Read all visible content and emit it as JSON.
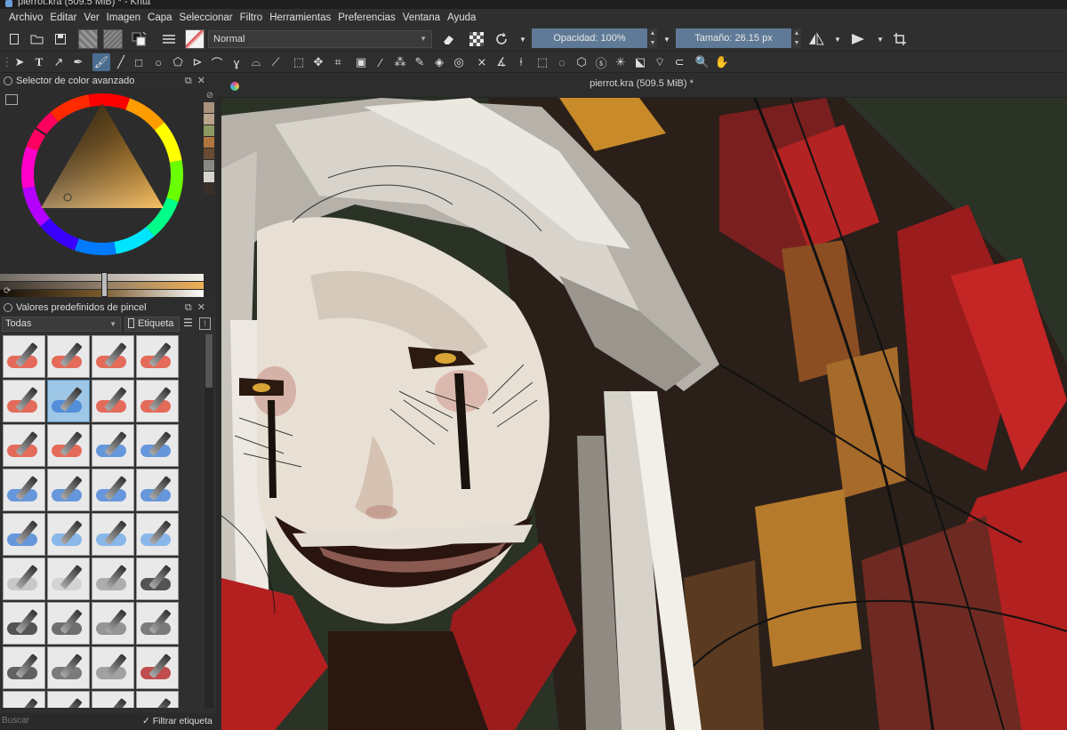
{
  "window": {
    "title": "pierrot.kra (509.5 MiB) * - Krita"
  },
  "menu": {
    "items": [
      "Archivo",
      "Editar",
      "Ver",
      "Imagen",
      "Capa",
      "Seleccionar",
      "Filtro",
      "Herramientas",
      "Preferencias",
      "Ventana",
      "Ayuda"
    ]
  },
  "toolbar": {
    "blend_mode": "Normal",
    "opacity_label": "Opacidad: 100%",
    "size_label": "Tamaño: 26.15 px"
  },
  "color_selector": {
    "title": "Selector de color avanzado",
    "history_colors": [
      "#a8927e",
      "#bba48c",
      "#8c9a62",
      "#b0763e",
      "#6a4a33",
      "#8a8a86",
      "#d8d5cf",
      "#3a2f28"
    ]
  },
  "brush_presets": {
    "title": "Valores predefinidos de pincel",
    "filter_value": "Todas",
    "tag_label": "Etiqueta",
    "search_placeholder": "Buscar",
    "filter_tag_label": "Filtrar etiqueta"
  },
  "document": {
    "tab_title": "pierrot.kra (509.5 MiB) *"
  },
  "colors": {
    "accent": "#4b6d8f",
    "slider": "#5f7a96",
    "canvas_bg": "#2b3226"
  }
}
